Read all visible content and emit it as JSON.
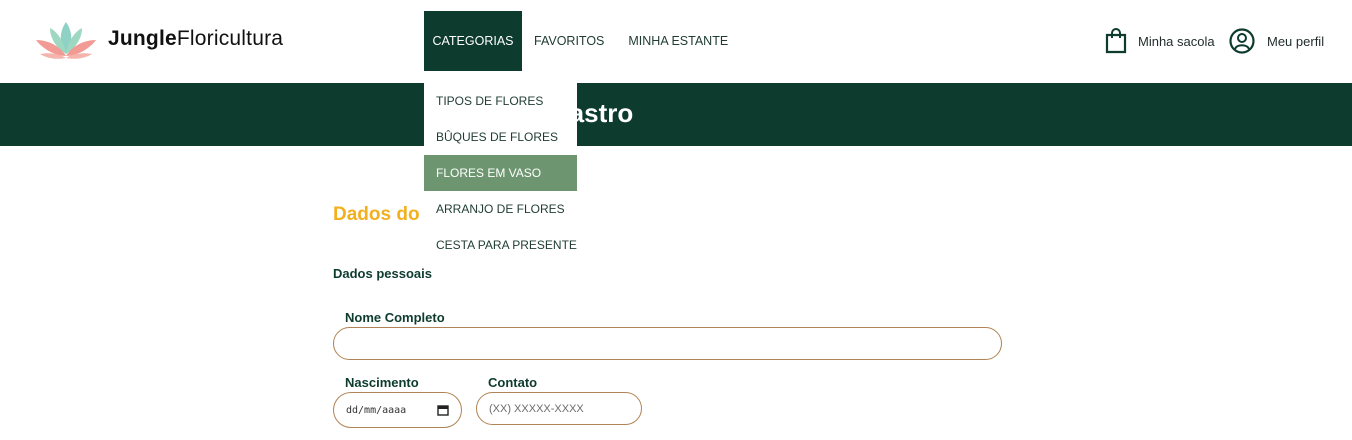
{
  "header": {
    "brand_bold": "Jungle",
    "brand_light": "Floricultura",
    "logo_icon": "lotus-icon",
    "nav": [
      "CATEGORIAS",
      "FAVORITOS",
      "MINHA ESTANTE"
    ],
    "bag_label": "Minha sacola",
    "profile_label": "Meu perfil"
  },
  "dropdown": {
    "items": [
      "TIPOS DE FLORES",
      "BÛQUES DE FLORES",
      "FLORES EM VASO",
      "ARRANJO DE FLORES",
      "CESTA PARA PRESENTE"
    ],
    "highlighted": "FLORES EM VASO"
  },
  "banner": {
    "title": "Tela de cadastro"
  },
  "form": {
    "section_title": "Dados do",
    "subsection": "Dados pessoais",
    "name_label": "Nome Completo",
    "name_value": "",
    "birth_label": "Nascimento",
    "birth_placeholder": "dd/mm/aaaa",
    "contact_label": "Contato",
    "contact_placeholder": "(XX) XXXXX-XXXX"
  },
  "colors": {
    "primary": "#0d3b2e",
    "accent": "#f2b01e",
    "hover": "#6d9670",
    "border": "#b08354"
  }
}
